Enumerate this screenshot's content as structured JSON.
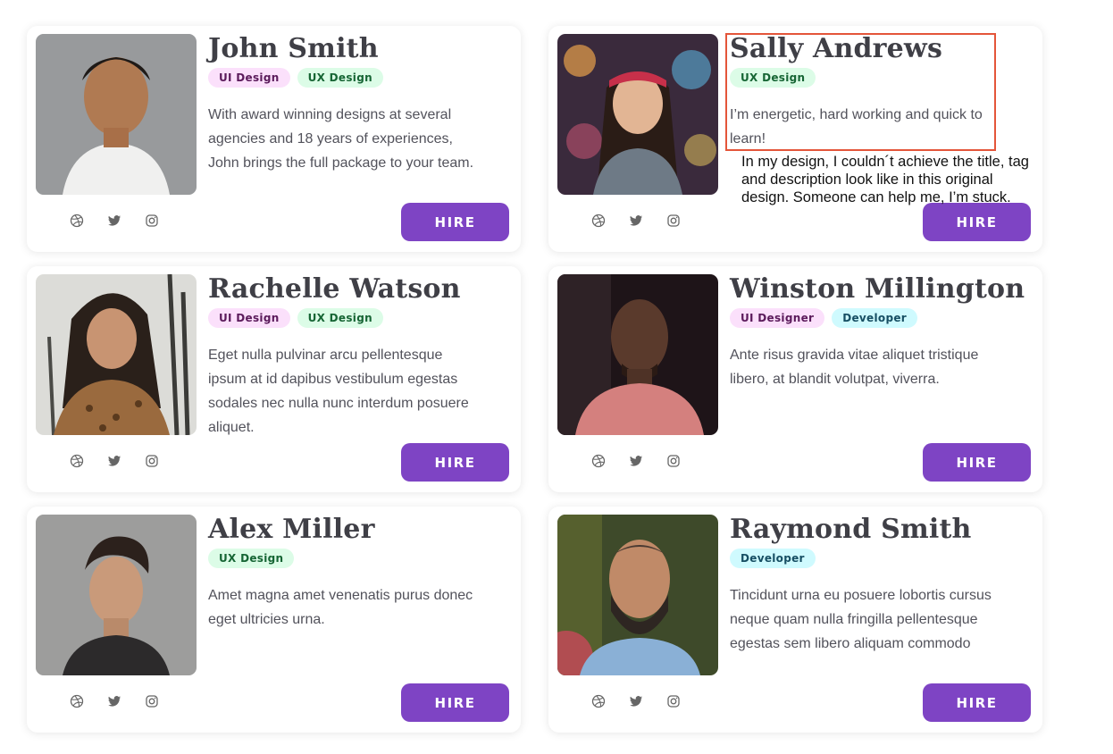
{
  "cards": [
    {
      "name": "John Smith",
      "tags": [
        {
          "label": "UI Design",
          "kind": "ui"
        },
        {
          "label": "UX Design",
          "kind": "ux"
        }
      ],
      "description": "With award winning designs at several agencies and 18 years of experiences, John brings the full package to your team.",
      "hire_label": "HIRE"
    },
    {
      "name": "Sally Andrews",
      "tags": [
        {
          "label": "UX Design",
          "kind": "ux"
        }
      ],
      "description": "I’m energetic, hard working and quick to learn!",
      "hire_label": "HIRE"
    },
    {
      "name": "Rachelle Watson",
      "tags": [
        {
          "label": "UI Design",
          "kind": "ui"
        },
        {
          "label": "UX Design",
          "kind": "ux"
        }
      ],
      "description": "Eget nulla pulvinar arcu pellentesque ipsum at id dapibus vestibulum egestas sodales nec nulla nunc interdum posuere aliquet.",
      "hire_label": "HIRE"
    },
    {
      "name": "Winston Millington",
      "tags": [
        {
          "label": "UI Designer",
          "kind": "ui"
        },
        {
          "label": "Developer",
          "kind": "dev"
        }
      ],
      "description": "Ante risus gravida vitae aliquet tristique libero, at blandit volutpat, viverra.",
      "hire_label": "HIRE"
    },
    {
      "name": "Alex Miller",
      "tags": [
        {
          "label": "UX Design",
          "kind": "ux"
        }
      ],
      "description": "Amet magna amet venenatis purus donec eget ultricies urna.",
      "hire_label": "HIRE"
    },
    {
      "name": "Raymond Smith",
      "tags": [
        {
          "label": "Developer",
          "kind": "dev"
        }
      ],
      "description": "Tincidunt urna eu posuere lobortis cursus neque quam nulla fringilla pellentesque egestas sem libero aliquam commodo",
      "hire_label": "HIRE"
    }
  ],
  "social_icons": [
    "dribbble-icon",
    "twitter-icon",
    "instagram-icon"
  ],
  "annotation_note": "In my design, I couldn´t achieve the title, tag and description look like in this original design. Someone can help me, I’m stuck.",
  "colors": {
    "hire_button": "#7e44c4",
    "highlight_border": "#e4553a",
    "tag_ui_bg": "#fbe0fb",
    "tag_ux_bg": "#dcfce7",
    "tag_dev_bg": "#cffafe"
  }
}
